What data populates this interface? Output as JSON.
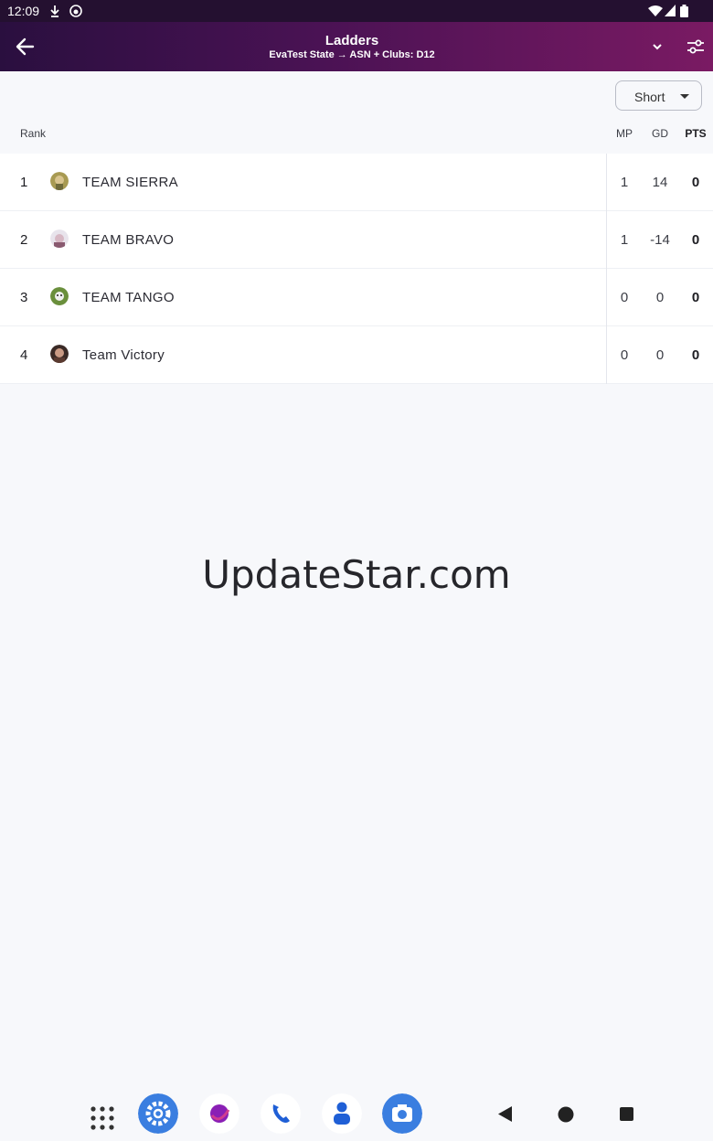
{
  "status_bar": {
    "time": "12:09"
  },
  "app_bar": {
    "title": "Ladders",
    "subtitle": "EvaTest State → ASN + Clubs: D12"
  },
  "view_select": {
    "selected": "Short"
  },
  "table": {
    "headers": {
      "rank": "Rank",
      "mp": "MP",
      "gd": "GD",
      "pts": "PTS"
    },
    "rows": [
      {
        "rank": "1",
        "team": "TEAM SIERRA",
        "mp": "1",
        "gd": "14",
        "pts": "0"
      },
      {
        "rank": "2",
        "team": "TEAM BRAVO",
        "mp": "1",
        "gd": "-14",
        "pts": "0"
      },
      {
        "rank": "3",
        "team": "TEAM TANGO",
        "mp": "0",
        "gd": "0",
        "pts": "0"
      },
      {
        "rank": "4",
        "team": "Team Victory",
        "mp": "0",
        "gd": "0",
        "pts": "0"
      }
    ]
  },
  "watermark": "UpdateStar.com",
  "colors": {
    "appbar_start": "#2a0f3f",
    "appbar_end": "#7a1a63"
  },
  "dock_icons": [
    "apps-grid-icon",
    "settings-icon",
    "browser-icon",
    "phone-icon",
    "contacts-icon",
    "camera-icon"
  ],
  "nav_icons": [
    "back-icon",
    "home-icon",
    "recents-icon"
  ]
}
